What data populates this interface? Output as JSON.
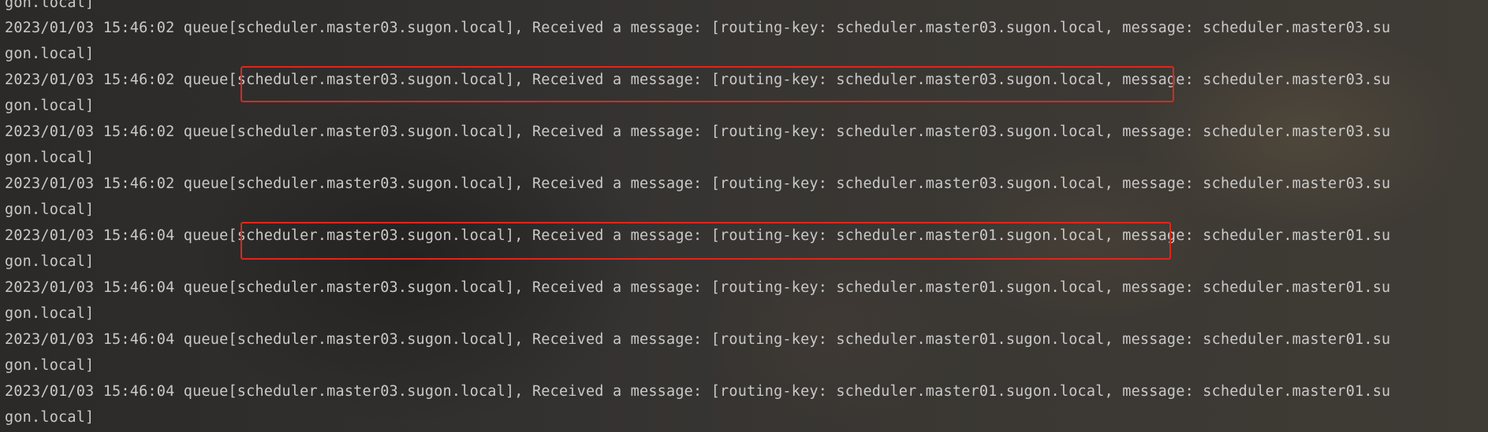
{
  "console": {
    "lines": [
      "gon.local]",
      "2023/01/03 15:46:02 queue[scheduler.master03.sugon.local], Received a message: [routing-key: scheduler.master03.sugon.local, message: scheduler.master03.su",
      "gon.local]",
      "2023/01/03 15:46:02 queue[scheduler.master03.sugon.local], Received a message: [routing-key: scheduler.master03.sugon.local, message: scheduler.master03.su",
      "gon.local]",
      "2023/01/03 15:46:02 queue[scheduler.master03.sugon.local], Received a message: [routing-key: scheduler.master03.sugon.local, message: scheduler.master03.su",
      "gon.local]",
      "2023/01/03 15:46:02 queue[scheduler.master03.sugon.local], Received a message: [routing-key: scheduler.master03.sugon.local, message: scheduler.master03.su",
      "gon.local]",
      "2023/01/03 15:46:04 queue[scheduler.master03.sugon.local], Received a message: [routing-key: scheduler.master01.sugon.local, message: scheduler.master01.su",
      "gon.local]",
      "2023/01/03 15:46:04 queue[scheduler.master03.sugon.local], Received a message: [routing-key: scheduler.master01.sugon.local, message: scheduler.master01.su",
      "gon.local]",
      "2023/01/03 15:46:04 queue[scheduler.master03.sugon.local], Received a message: [routing-key: scheduler.master01.sugon.local, message: scheduler.master01.su",
      "gon.local]",
      "2023/01/03 15:46:04 queue[scheduler.master03.sugon.local], Received a message: [routing-key: scheduler.master01.sugon.local, message: scheduler.master01.su",
      "gon.local]"
    ]
  },
  "colors": {
    "text": "#c9c9c9",
    "highlight_border": "#e0261b"
  }
}
